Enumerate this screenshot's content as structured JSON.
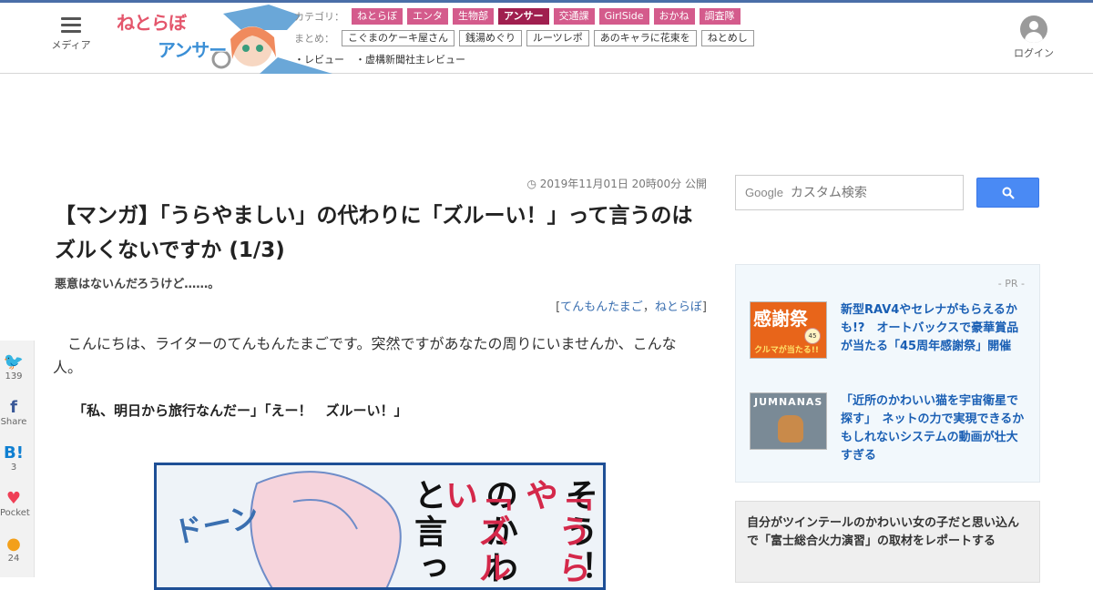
{
  "header": {
    "menu_label": "メディア",
    "logo_text_line1": "ねとらぼ",
    "logo_text_line2": "アンサー",
    "category_label": "カテゴリ：",
    "categories": [
      "ねとらぼ",
      "エンタ",
      "生物部",
      "アンサー",
      "交通課",
      "GirlSide",
      "おかね",
      "調査隊"
    ],
    "summary_label": "まとめ：",
    "summaries": [
      "こぐまのケーキ屋さん",
      "銭湯めぐり",
      "ルーツレポ",
      "あのキャラに花束を",
      "ねとめし"
    ],
    "reviews": [
      "・レビュー",
      "・虚構新聞社主レビュー"
    ],
    "login_label": "ログイン"
  },
  "article": {
    "date": "2019年11月01日 20時00分 公開",
    "title": "【マンガ】「うらやましい」の代わりに「ズルーい！」って言うのはズルくないですか (1/3)",
    "subtitle": "悪意はないんだろうけど……。",
    "byline_author": "てんもんたまご",
    "byline_site": "ねとらぼ",
    "body_paragraph": "こんにちは、ライターのてんもんたまごです。突然ですがあなたの周りにいませんか、こんな人。",
    "quote": "「私、明日から旅行なんだー」「えー！　ズルーい！」",
    "manga_cols": [
      "そう！",
      "「うらや",
      "のかわ",
      "「ズルい",
      "と言っ"
    ],
    "manga_sfx": "ドーン"
  },
  "share": [
    {
      "icon": "twitter-icon",
      "glyph": "🐦",
      "count": "139"
    },
    {
      "icon": "facebook-icon",
      "glyph": "f",
      "count": "Share"
    },
    {
      "icon": "hatena-icon",
      "glyph": "B!",
      "count": "3"
    },
    {
      "icon": "pocket-icon",
      "glyph": "♥",
      "count": "Pocket"
    },
    {
      "icon": "comment-icon",
      "glyph": "●",
      "count": "24"
    }
  ],
  "sidebar": {
    "google_label": "Google",
    "search_placeholder": "カスタム検索",
    "pr_label": "- PR -",
    "pr_items": [
      {
        "thumb_text": "感謝祭",
        "thumb_sub": "クルマが当たる!!",
        "thumb_badge": "45",
        "text": "新型RAV4やセレナがもらえるかも!?　オートバックスで豪華賞品が当たる「45周年感謝祭」開催"
      },
      {
        "thumb_text": "JUMNANAS",
        "text": "「近所のかわいい猫を宇宙衛星で探す」　ネットの力で実現できるかもしれないシステムの動画が壮大すぎる"
      }
    ],
    "related_text": "自分がツインテールのかわいい女の子だと思い込んで「富士総合火力演習」の取材をレポートする"
  },
  "colors": {
    "accent": "#4a6ea8",
    "category_tag": "#d45b8c",
    "category_active": "#a01f4f",
    "link": "#1a5fb4"
  }
}
